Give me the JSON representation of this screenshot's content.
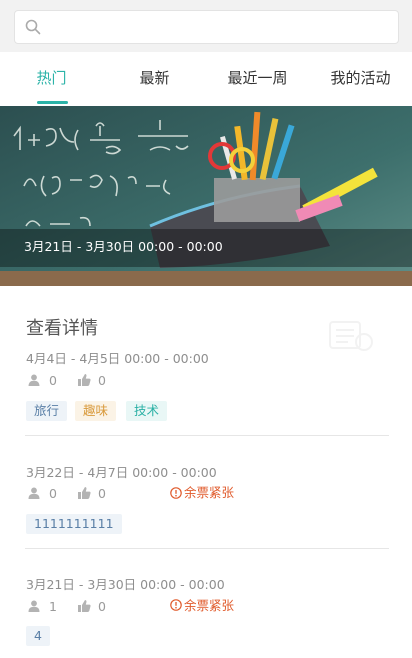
{
  "search": {
    "placeholder": "",
    "value": ""
  },
  "tabs": [
    {
      "label": "热门",
      "active": true
    },
    {
      "label": "最新",
      "active": false
    },
    {
      "label": "最近一周",
      "active": false
    },
    {
      "label": "我的活动",
      "active": false
    }
  ],
  "banner": {
    "caption": "3月21日 - 3月30日 00:00 - 00:00"
  },
  "activities": [
    {
      "title": "查看详情",
      "date": "4月4日 - 4月5日 00:00 - 00:00",
      "participants": "0",
      "likes": "0",
      "warning": "",
      "tags": [
        "旅行",
        "趣味",
        "技术"
      ]
    },
    {
      "title": "",
      "date": "3月22日 - 4月7日 00:00 - 00:00",
      "participants": "0",
      "likes": "0",
      "warning": "余票紧张",
      "tags": [
        "1111111111"
      ]
    },
    {
      "title": "",
      "date": "3月21日 - 3月30日 00:00 - 00:00",
      "participants": "1",
      "likes": "0",
      "warning": "余票紧张",
      "tags": [
        "4"
      ]
    }
  ],
  "colors": {
    "accent": "#2bb3a8",
    "warning": "#e05a2b",
    "tag_blue": "#5a7fa6",
    "tag_orange": "#d99a3c",
    "tag_teal": "#2ab0a5"
  },
  "icons": {
    "search": "search-icon",
    "participants": "person-icon",
    "likes": "thumbs-up-icon",
    "warning": "alert-circle-icon"
  }
}
